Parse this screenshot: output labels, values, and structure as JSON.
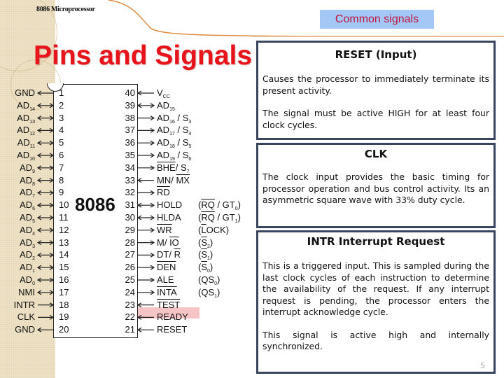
{
  "header": {
    "course_label": "8086 Microprocessor",
    "title": "Pins and Signals",
    "badge": "Common signals"
  },
  "chip": {
    "name": "8086",
    "highlight_pin": 22,
    "highlight_color": "#f5c4c4",
    "left_pins": [
      {
        "num": "1",
        "label": "GND",
        "sub": "",
        "dir": "out"
      },
      {
        "num": "2",
        "label": "AD",
        "sub": "14",
        "dir": "bi"
      },
      {
        "num": "3",
        "label": "AD",
        "sub": "13",
        "dir": "bi"
      },
      {
        "num": "4",
        "label": "AD",
        "sub": "12",
        "dir": "bi"
      },
      {
        "num": "5",
        "label": "AD",
        "sub": "11",
        "dir": "bi"
      },
      {
        "num": "6",
        "label": "AD",
        "sub": "10",
        "dir": "bi"
      },
      {
        "num": "7",
        "label": "AD",
        "sub": "9",
        "dir": "bi"
      },
      {
        "num": "8",
        "label": "AD",
        "sub": "8",
        "dir": "bi"
      },
      {
        "num": "9",
        "label": "AD",
        "sub": "7",
        "dir": "bi"
      },
      {
        "num": "10",
        "label": "AD",
        "sub": "6",
        "dir": "bi"
      },
      {
        "num": "11",
        "label": "AD",
        "sub": "5",
        "dir": "bi"
      },
      {
        "num": "12",
        "label": "AD",
        "sub": "4",
        "dir": "bi"
      },
      {
        "num": "13",
        "label": "AD",
        "sub": "3",
        "dir": "bi"
      },
      {
        "num": "14",
        "label": "AD",
        "sub": "2",
        "dir": "bi"
      },
      {
        "num": "15",
        "label": "AD",
        "sub": "1",
        "dir": "bi"
      },
      {
        "num": "16",
        "label": "AD",
        "sub": "0",
        "dir": "bi"
      },
      {
        "num": "17",
        "label": "NMI",
        "sub": "",
        "dir": "bi"
      },
      {
        "num": "18",
        "label": "INTR",
        "sub": "",
        "dir": "in"
      },
      {
        "num": "19",
        "label": "CLK",
        "sub": "",
        "dir": "in"
      },
      {
        "num": "20",
        "label": "GND",
        "sub": "",
        "dir": "out"
      }
    ],
    "right_pins": [
      {
        "num": "40",
        "html": "V<sub>CC</sub>",
        "dir": "in",
        "alt": ""
      },
      {
        "num": "39",
        "html": "AD<sub>15</sub>",
        "dir": "bi",
        "alt": ""
      },
      {
        "num": "38",
        "html": "AD<sub>16</sub> / S<sub>3</sub>",
        "dir": "out",
        "alt": ""
      },
      {
        "num": "37",
        "html": "AD<sub>17</sub> / S<sub>4</sub>",
        "dir": "out",
        "alt": ""
      },
      {
        "num": "36",
        "html": "AD<sub>18</sub> / S<sub>5</sub>",
        "dir": "out",
        "alt": ""
      },
      {
        "num": "35",
        "html": "AD<sub>19</sub> / S<sub>6</sub>",
        "dir": "out",
        "alt": ""
      },
      {
        "num": "34",
        "html": "<span class=\"ovl\">BHE</span>/ S<sub>7</sub>",
        "dir": "out",
        "alt": ""
      },
      {
        "num": "33",
        "html": "MN/ <span class=\"ovl\">MX</span>",
        "dir": "in",
        "alt": ""
      },
      {
        "num": "32",
        "html": "<span class=\"ovl\">RD</span>",
        "dir": "out",
        "alt": ""
      },
      {
        "num": "31",
        "html": "HOLD",
        "dir": "bi",
        "alt": "(<span class=\"ovl\">RQ</span> / GT<sub>0</sub>)"
      },
      {
        "num": "30",
        "html": "HLDA",
        "dir": "bi",
        "alt": "(<span class=\"ovl\">RQ</span> / GT<sub>1</sub>)"
      },
      {
        "num": "29",
        "html": "<span class=\"ovl\">WR</span>",
        "dir": "out",
        "alt": "(<span class=\"ovl\">L</span>OCK)"
      },
      {
        "num": "28",
        "html": "M/ <span class=\"ovl\">IO</span>",
        "dir": "out",
        "alt": "(<span class=\"ovl\">S</span><sub>2</sub>)"
      },
      {
        "num": "27",
        "html": "DT/ <span class=\"ovl\">R</span>",
        "dir": "out",
        "alt": "(<span class=\"ovl\">S</span><sub>1</sub>)"
      },
      {
        "num": "26",
        "html": "<span class=\"ovl\">DEN</span>",
        "dir": "out",
        "alt": "(<span class=\"ovl\">S</span><sub>0</sub>)"
      },
      {
        "num": "25",
        "html": "ALE",
        "dir": "out",
        "alt": "(QS<sub>0</sub>)"
      },
      {
        "num": "24",
        "html": "<span class=\"ovl\">INTA</span>",
        "dir": "out",
        "alt": "(QS<sub>1</sub>)"
      },
      {
        "num": "23",
        "html": "<span class=\"ovl\">TEST</span>",
        "dir": "in",
        "alt": ""
      },
      {
        "num": "22",
        "html": "READY",
        "dir": "in",
        "alt": ""
      },
      {
        "num": "21",
        "html": "RESET",
        "dir": "in",
        "alt": ""
      }
    ]
  },
  "signals": [
    {
      "title": "RESET (Input)",
      "paragraphs": [
        "Causes the processor to immediately terminate its present activity.",
        "The signal must be active HIGH for at least four clock cycles."
      ]
    },
    {
      "title": "CLK",
      "paragraphs": [
        "The clock input provides the basic timing for processor operation and bus control activity. Its an asymmetric square wave with 33% duty cycle."
      ]
    },
    {
      "title": "INTR Interrupt Request",
      "paragraphs": [
        "This is a triggered input. This is sampled during the last clock cycles of each instruction to determine the availability of the request. If any interrupt request is pending, the processor enters the interrupt acknowledge cycle.",
        "This signal is active high and internally synchronized."
      ]
    }
  ],
  "page_number": "5",
  "colors": {
    "title_red": "#e8141c",
    "badge_bg": "#a3c8f5",
    "badge_text": "#c0143c",
    "box_border": "#3a4660",
    "left_band": "#efe3c7"
  }
}
